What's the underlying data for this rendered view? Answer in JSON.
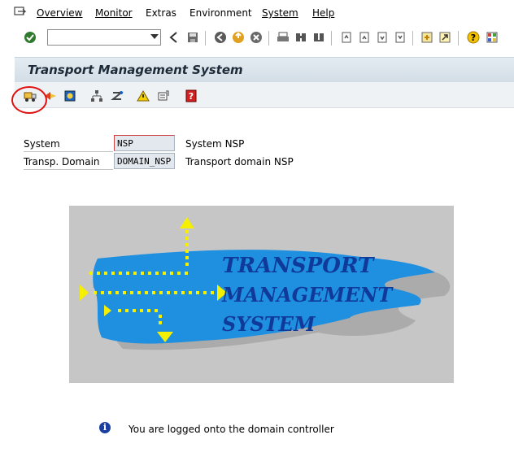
{
  "menubar": {
    "items": [
      "Overview",
      "Monitor",
      "Extras",
      "Environment",
      "System",
      "Help"
    ]
  },
  "title": "Transport Management System",
  "fields": [
    {
      "label": "System",
      "value": "NSP",
      "description": "System NSP"
    },
    {
      "label": "Transp. Domain",
      "value": "DOMAIN_NSP",
      "description": "Transport domain NSP"
    }
  ],
  "logo": {
    "line1": "TRANSPORT",
    "line2": "MANAGEMENT",
    "line3": "SYSTEM"
  },
  "status": {
    "message": "You are logged onto the domain controller",
    "icon": "info-icon"
  },
  "colors": {
    "accent_blue": "#1f8fe0",
    "arrow_yellow": "#f5f000",
    "highlight": "#e01010"
  }
}
